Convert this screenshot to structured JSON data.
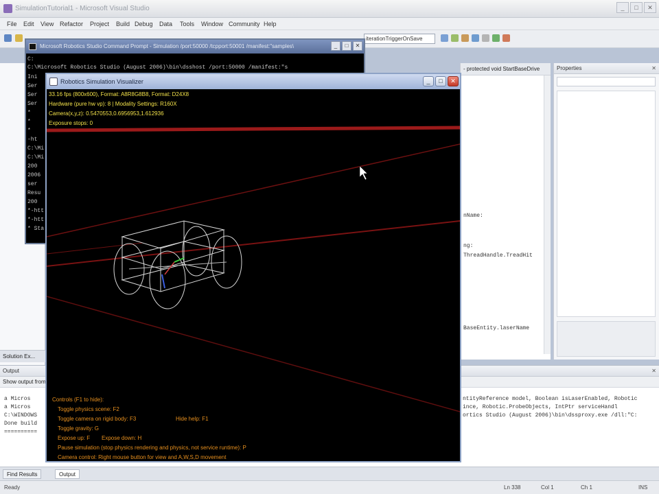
{
  "vs": {
    "title": "SimulationTutorial1 - Microsoft Visual Studio",
    "menu": [
      "File",
      "Edit",
      "View",
      "Refactor",
      "Project",
      "Build",
      "Debug",
      "Data",
      "Tools",
      "Window",
      "Community",
      "Help"
    ],
    "config_combo": "iterationTriggerOnSave",
    "window_controls": [
      "_",
      "□",
      "✕"
    ]
  },
  "cmd": {
    "title": "Microsoft Robotics Studio Command Prompt - Simulation /port:50000 /tcpport:50001 /manifest:\"samples\\",
    "prompt_line": "C:\\Microsoft Robotics Studio (August 2006)\\bin\\dsshost /port:50000 /manifest:\"s",
    "first_line": "C:",
    "fragments": [
      "Ini",
      "Ser",
      "Ser",
      "Ser",
      "*",
      "*",
      "*",
      "-ht",
      "C:\\Mi",
      "C:\\Mi",
      "200",
      "2006",
      "ser",
      "Resu",
      "200",
      "*-htt",
      "*-htt",
      "* Sta"
    ]
  },
  "sim": {
    "title": "Robotics Simulation Visualizer",
    "hud": [
      "33.16 fps (800x600), Format: A8R8G8B8, Format: D24X8",
      "Hardware (pure hw vp): 8 | Modality Settings: R160X",
      "Camera(x,y,z): 0.5470553,0.6956953,1.612936",
      "Exposure stops: 0"
    ],
    "help": [
      "Controls (F1 to hide):",
      "Toggle physics scene: F2",
      "Toggle camera on rigid body: F3",
      "Hide help: F1",
      "Toggle gravity: G",
      "Expose up: F",
      "Expose down: H",
      "Pause simulation (stop physics rendering and physics, not service runtime): P",
      "Camera control: Right mouse button for view and A,W,S,D movement"
    ]
  },
  "code": {
    "header": "- protected void StartBaseDrive",
    "lines": [
      "nName:",
      "ng:",
      "ThreadHandle.TreadHit",
      "BaseEntity.laserName"
    ]
  },
  "properties": {
    "title": "Properties"
  },
  "solution": {
    "title": "Solution Ex..."
  },
  "output": {
    "title": "Output",
    "show_output_from": "Show output from:",
    "lines": [
      "a Micros",
      "a Micros",
      "C:\\WINDOWS",
      "Done build",
      "==========",
      "ntityReference model, Boolean isLaserEnabled, Robotic",
      "ince, Robotic.ProbeObjects, IntPtr serviceHandl",
      "ortics Studio (August 2006)\\bin\\dssproxy.exe /dll:\"C:"
    ]
  },
  "bottom_tabs": [
    "Find Results",
    "Output"
  ],
  "status": {
    "ready": "Ready",
    "ln": "Ln 338",
    "col": "Col 1",
    "ch": "Ch 1",
    "ins": "INS"
  }
}
